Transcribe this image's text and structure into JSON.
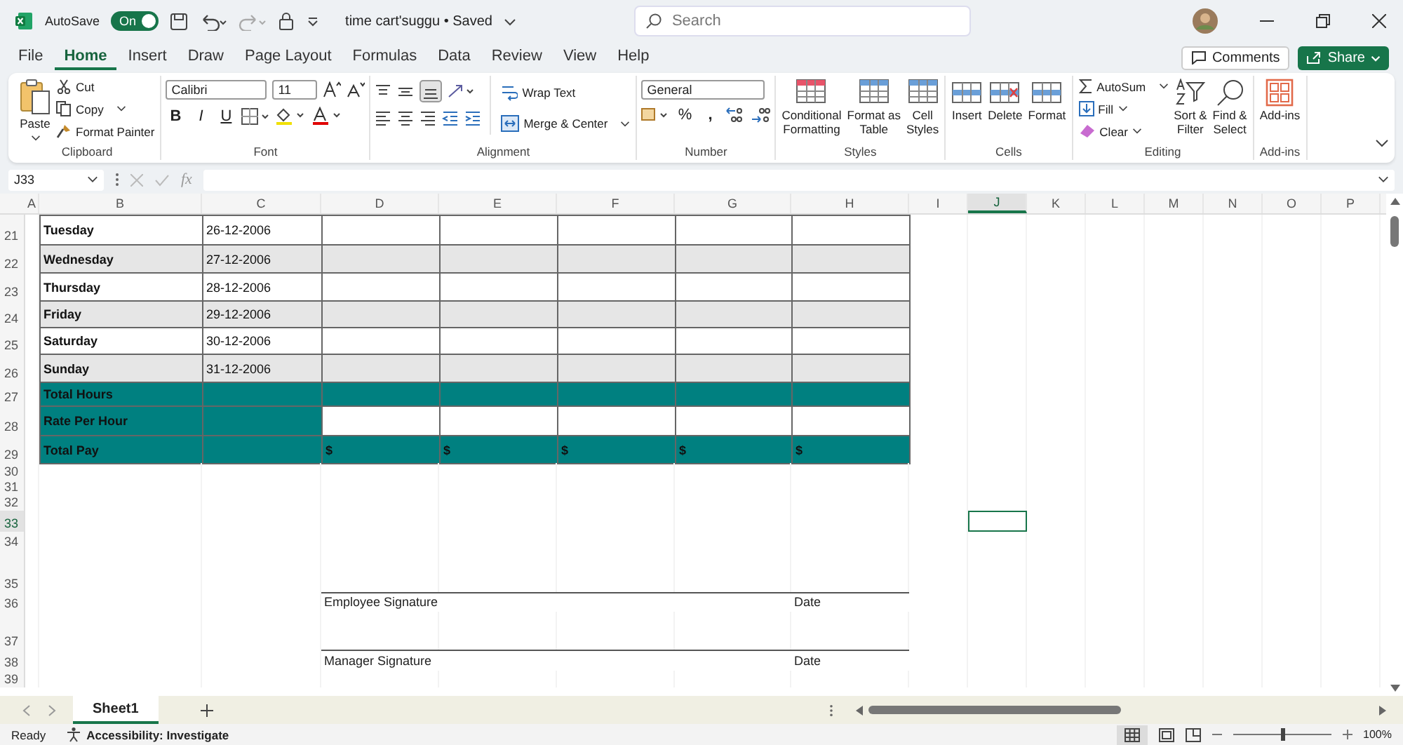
{
  "title_bar": {
    "autosave_label": "AutoSave",
    "autosave": {
      "on": true,
      "label": "On"
    },
    "document_title": "time cart'suggu • Saved",
    "search": {
      "placeholder": "Search"
    }
  },
  "menu_tabs": [
    {
      "label": "File",
      "selected": false
    },
    {
      "label": "Home",
      "selected": true
    },
    {
      "label": "Insert",
      "selected": false
    },
    {
      "label": "Draw",
      "selected": false
    },
    {
      "label": "Page Layout",
      "selected": false
    },
    {
      "label": "Formulas",
      "selected": false
    },
    {
      "label": "Data",
      "selected": false
    },
    {
      "label": "Review",
      "selected": false
    },
    {
      "label": "View",
      "selected": false
    },
    {
      "label": "Help",
      "selected": false
    }
  ],
  "header_buttons": {
    "comments": "Comments",
    "share": "Share"
  },
  "ribbon": {
    "clipboard": {
      "label": "Clipboard",
      "paste": "Paste",
      "cut": "Cut",
      "copy": "Copy",
      "format_painter": "Format Painter"
    },
    "font": {
      "label": "Font",
      "font_name": "Calibri",
      "font_size": "11",
      "bold": "B",
      "italic": "I",
      "underline": "U"
    },
    "alignment": {
      "label": "Alignment",
      "wrap_text": "Wrap Text",
      "merge": "Merge & Center"
    },
    "number": {
      "label": "Number",
      "format": "General",
      "percent": "%",
      "comma": ","
    },
    "styles": {
      "label": "Styles",
      "buttons": [
        "Conditional\nFormatting",
        "Format as\nTable",
        "Cell\nStyles"
      ]
    },
    "cells": {
      "label": "Cells",
      "buttons": [
        "Insert",
        "Delete",
        "Format"
      ]
    },
    "editing": {
      "label": "Editing",
      "autosum": "AutoSum",
      "fill": "Fill",
      "clear": "Clear",
      "sort": "Sort &\nFilter",
      "find": "Find &\nSelect"
    },
    "addins": {
      "label": "Add-ins",
      "button": "Add-ins"
    }
  },
  "formula_bar": {
    "name_box": "J33",
    "fx": "fx"
  },
  "columns": [
    {
      "label": "A",
      "selected": false
    },
    {
      "label": "B",
      "selected": false
    },
    {
      "label": "C",
      "selected": false
    },
    {
      "label": "D",
      "selected": false
    },
    {
      "label": "E",
      "selected": false
    },
    {
      "label": "F",
      "selected": false
    },
    {
      "label": "G",
      "selected": false
    },
    {
      "label": "H",
      "selected": false
    },
    {
      "label": "I",
      "selected": false
    },
    {
      "label": "J",
      "selected": true
    },
    {
      "label": "K",
      "selected": false
    },
    {
      "label": "L",
      "selected": false
    },
    {
      "label": "M",
      "selected": false
    },
    {
      "label": "N",
      "selected": false
    },
    {
      "label": "O",
      "selected": false
    },
    {
      "label": "P",
      "selected": false
    }
  ],
  "rows": [
    {
      "number": "21",
      "kind": "day",
      "shaded": false,
      "selected": false,
      "day": "Tuesday",
      "date": "26-12-2006"
    },
    {
      "number": "22",
      "kind": "day",
      "shaded": true,
      "selected": false,
      "day": "Wednesday",
      "date": "27-12-2006"
    },
    {
      "number": "23",
      "kind": "day",
      "shaded": false,
      "selected": false,
      "day": "Thursday",
      "date": "28-12-2006"
    },
    {
      "number": "24",
      "kind": "day",
      "shaded": true,
      "selected": false,
      "day": "Friday",
      "date": "29-12-2006"
    },
    {
      "number": "25",
      "kind": "day",
      "shaded": false,
      "selected": false,
      "day": "Saturday",
      "date": "30-12-2006"
    },
    {
      "number": "26",
      "kind": "day",
      "shaded": true,
      "selected": false,
      "day": "Sunday",
      "date": "31-12-2006"
    },
    {
      "number": "27",
      "kind": "total",
      "selected": false,
      "label": "Total Hours"
    },
    {
      "number": "28",
      "kind": "rate",
      "selected": false,
      "label": "Rate Per Hour"
    },
    {
      "number": "29",
      "kind": "pay",
      "selected": false,
      "label": "Total Pay",
      "values": [
        "$",
        "$",
        "$",
        "$",
        "$"
      ]
    },
    {
      "number": "30",
      "kind": "blank",
      "selected": false
    },
    {
      "number": "31",
      "kind": "blank",
      "selected": false
    },
    {
      "number": "32",
      "kind": "blank",
      "selected": false
    },
    {
      "number": "33",
      "kind": "blank",
      "selected": true
    },
    {
      "number": "34",
      "kind": "blank",
      "selected": false
    },
    {
      "number": "35",
      "kind": "blank",
      "selected": false
    },
    {
      "number": "36",
      "kind": "signature",
      "selected": false,
      "label": "Employee Signature",
      "date": "Date"
    },
    {
      "number": "37",
      "kind": "blank",
      "selected": false
    },
    {
      "number": "38",
      "kind": "signature",
      "selected": false,
      "label": "Manager Signature",
      "date": "Date"
    },
    {
      "number": "39",
      "kind": "blank",
      "selected": false
    }
  ],
  "sheet_tabs": [
    {
      "label": "Sheet1",
      "selected": true
    }
  ],
  "status_bar": {
    "ready": "Ready",
    "accessibility": "Accessibility: Investigate",
    "zoom": {
      "level": 0.5,
      "reading": "100%"
    }
  }
}
